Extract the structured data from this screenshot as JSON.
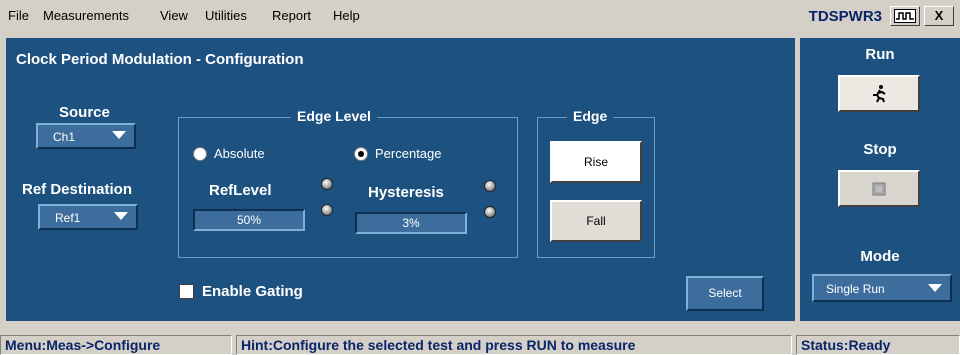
{
  "menu": {
    "items": [
      "File",
      "Measurements",
      "View",
      "Utilities",
      "Report",
      "Help"
    ],
    "app_name": "TDSPWR3",
    "wave_button_icon": "waveform-icon",
    "close_label": "X"
  },
  "panel": {
    "title": "Clock Period Modulation - Configuration",
    "source": {
      "label": "Source",
      "value": "Ch1"
    },
    "ref_destination": {
      "label": "Ref Destination",
      "value": "Ref1"
    },
    "edge_level": {
      "caption": "Edge Level",
      "absolute_label": "Absolute",
      "percentage_label": "Percentage",
      "selected": "Percentage",
      "reflevel_label": "RefLevel",
      "reflevel_value": "50%",
      "hysteresis_label": "Hysteresis",
      "hysteresis_value": "3%"
    },
    "edge": {
      "caption": "Edge",
      "rise_label": "Rise",
      "fall_label": "Fall",
      "selected": "Rise"
    },
    "enable_gating_label": "Enable Gating",
    "enable_gating_checked": false,
    "select_label": "Select"
  },
  "side": {
    "run_label": "Run",
    "run_icon": "running-man-icon",
    "stop_label": "Stop",
    "stop_icon": "stop-square-icon",
    "mode_label": "Mode",
    "mode_value": "Single Run"
  },
  "status": {
    "menu_path": "Menu:Meas->Configure",
    "hint": "Hint:Configure the selected test and press RUN to measure",
    "state": "Status:Ready"
  },
  "colors": {
    "panel_bg": "#1d5280",
    "field_bg": "#3d6d9c",
    "chrome": "#d4d0c8",
    "status_text": "#0a246a"
  }
}
